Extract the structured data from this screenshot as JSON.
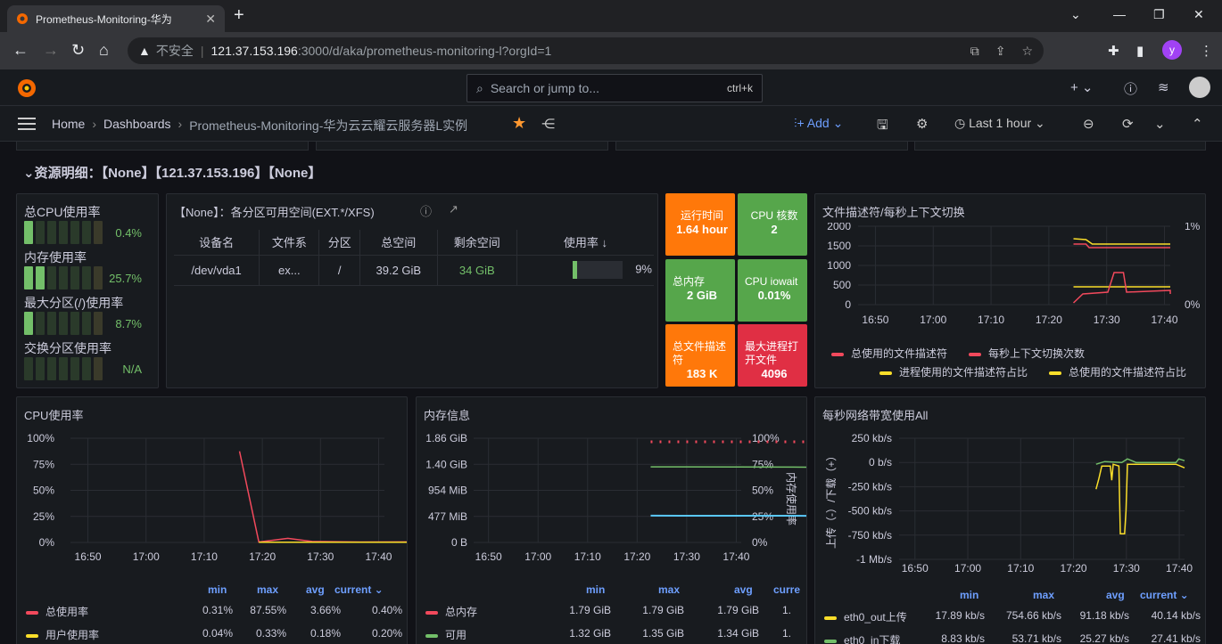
{
  "browser": {
    "tab_title": "Prometheus-Monitoring-华为",
    "insecure_label": "不安全",
    "url_host": "121.37.153.196",
    "url_rest": ":3000/d/aka/prometheus-monitoring-l?orgId=1",
    "avatar_letter": "y"
  },
  "grafana": {
    "search_placeholder": "Search or jump to...",
    "search_shortcut": "ctrl+k",
    "breadcrumb": [
      "Home",
      "Dashboards",
      "Prometheus-Monitoring-华为云云耀云服务器L实例"
    ],
    "add_label": "Add",
    "time_range": "Last 1 hour"
  },
  "row_title": "资源明细：【None】【121.37.153.196】【None】",
  "bargauge": {
    "items": [
      {
        "label": "总CPU使用率",
        "value": "0.4%",
        "fraction": 0.004
      },
      {
        "label": "内存使用率",
        "value": "25.7%",
        "fraction": 0.257
      },
      {
        "label": "最大分区(/)使用率",
        "value": "8.7%",
        "fraction": 0.087
      },
      {
        "label": "交换分区使用率",
        "value": "N/A",
        "fraction": 0
      }
    ]
  },
  "disk_table": {
    "title": "【None】：各分区可用空间(EXT.*/XFS)",
    "headers": [
      "设备名",
      "文件系",
      "分区",
      "总空间",
      "剩余空间",
      "使用率 ↓"
    ],
    "rows": [
      [
        "/dev/vda1",
        "ex...",
        "/",
        "39.2 GiB",
        "34 GiB",
        "9%"
      ]
    ],
    "usage_fraction": 0.09
  },
  "stats": [
    {
      "label": "运行时间",
      "value": "1.64 hour",
      "color": "#ff780a"
    },
    {
      "label": "CPU 核数",
      "value": "2",
      "color": "#56a64b"
    },
    {
      "label": "总内存",
      "value": "2 GiB",
      "color": "#56a64b"
    },
    {
      "label": "CPU iowait",
      "value": "0.01%",
      "color": "#56a64b"
    },
    {
      "label": "总文件描述符",
      "value": "183 K",
      "color": "#ff780a"
    },
    {
      "label": "最大进程打开文件",
      "value": "4096",
      "color": "#e02f44"
    }
  ],
  "fd_panel": {
    "title": "文件描述符/每秒上下文切换",
    "legend": [
      {
        "name": "总使用的文件描述符",
        "color": "#f2495c"
      },
      {
        "name": "每秒上下文切换次数",
        "color": "#f2495c"
      },
      {
        "name": "进程使用的文件描述符占比",
        "color": "#fade2a"
      },
      {
        "name": "总使用的文件描述符占比",
        "color": "#fade2a"
      }
    ]
  },
  "cpu_panel": {
    "title": "CPU使用率",
    "legend_headers": [
      "min",
      "max",
      "avg",
      "current ⌄"
    ],
    "rows": [
      {
        "name": "总使用率",
        "color": "#f2495c",
        "min": "0.31%",
        "max": "87.55%",
        "avg": "3.66%",
        "current": "0.40%"
      },
      {
        "name": "用户使用率",
        "color": "#fade2a",
        "min": "0.04%",
        "max": "0.33%",
        "avg": "0.18%",
        "current": "0.20%"
      }
    ]
  },
  "mem_panel": {
    "title": "内存信息",
    "right_axis_label": "内存使用率",
    "legend_headers": [
      "min",
      "max",
      "avg",
      "curre"
    ],
    "rows": [
      {
        "name": "总内存",
        "color": "#f2495c",
        "min": "1.79 GiB",
        "max": "1.79 GiB",
        "avg": "1.79 GiB",
        "current": "1."
      },
      {
        "name": "可用",
        "color": "#73bf69",
        "min": "1.32 GiB",
        "max": "1.35 GiB",
        "avg": "1.34 GiB",
        "current": "1."
      }
    ]
  },
  "net_panel": {
    "title": "每秒网络带宽使用All",
    "y_axis_label": "上传（-）/下载（+）",
    "legend_headers": [
      "min",
      "max",
      "avg",
      "current ⌄"
    ],
    "rows": [
      {
        "name": "eth0_out上传",
        "color": "#fade2a",
        "min": "17.89 kb/s",
        "max": "754.66 kb/s",
        "avg": "91.18 kb/s",
        "current": "40.14 kb/s"
      },
      {
        "name": "eth0_in下载",
        "color": "#73bf69",
        "min": "8.83 kb/s",
        "max": "53.71 kb/s",
        "avg": "25.27 kb/s",
        "current": "27.41 kb/s"
      }
    ]
  },
  "chart_data": [
    {
      "type": "line",
      "panel": "CPU使用率",
      "x": [
        "16:50",
        "17:00",
        "17:10",
        "17:20",
        "17:30",
        "17:40"
      ],
      "yticks": [
        "100%",
        "75%",
        "50%",
        "25%",
        "0%"
      ],
      "ylim": [
        0,
        100
      ],
      "series": [
        {
          "name": "总使用率",
          "color": "#f2495c",
          "points": [
            [
              17.2,
              87.5
            ],
            [
              17.24,
              0.4
            ],
            [
              17.3,
              4
            ],
            [
              17.35,
              1
            ],
            [
              17.45,
              0.4
            ],
            [
              17.55,
              0.5
            ],
            [
              17.8,
              0.4
            ]
          ]
        },
        {
          "name": "用户使用率",
          "color": "#fade2a",
          "points": [
            [
              17.24,
              0.2
            ],
            [
              17.8,
              0.2
            ]
          ]
        }
      ]
    },
    {
      "type": "line",
      "panel": "内存信息",
      "x": [
        "16:50",
        "17:00",
        "17:10",
        "17:20",
        "17:30",
        "17:40"
      ],
      "yticks": [
        "1.86 GiB",
        "1.40 GiB",
        "954 MiB",
        "477 MiB",
        "0 B"
      ],
      "yticks_right": [
        "100%",
        "75%",
        "50%",
        "25%",
        "0%"
      ],
      "series": [
        {
          "name": "总内存",
          "color": "#f2495c",
          "style": "dotted",
          "points": [
            [
              17.28,
              1.86
            ],
            [
              17.9,
              1.86
            ]
          ]
        },
        {
          "name": "可用",
          "color": "#73bf69",
          "points": [
            [
              17.28,
              1.35
            ],
            [
              17.9,
              1.34
            ]
          ]
        },
        {
          "name": "内存使用率",
          "color": "#5ac8fa",
          "points": [
            [
              17.28,
              25.7
            ],
            [
              17.9,
              25.5
            ]
          ]
        }
      ]
    },
    {
      "type": "line",
      "panel": "文件描述符/每秒上下文切换",
      "x": [
        "16:50",
        "17:00",
        "17:10",
        "17:20",
        "17:30",
        "17:40"
      ],
      "yticks": [
        "2000",
        "1500",
        "1000",
        "500",
        "0"
      ],
      "yticks_right": [
        "1%",
        "0%"
      ]
    },
    {
      "type": "line",
      "panel": "每秒网络带宽使用All",
      "x": [
        "16:50",
        "17:00",
        "17:10",
        "17:20",
        "17:30",
        "17:40"
      ],
      "yticks": [
        "250 kb/s",
        "0 b/s",
        "-250 kb/s",
        "-500 kb/s",
        "-750 kb/s",
        "-1 Mb/s"
      ]
    }
  ]
}
